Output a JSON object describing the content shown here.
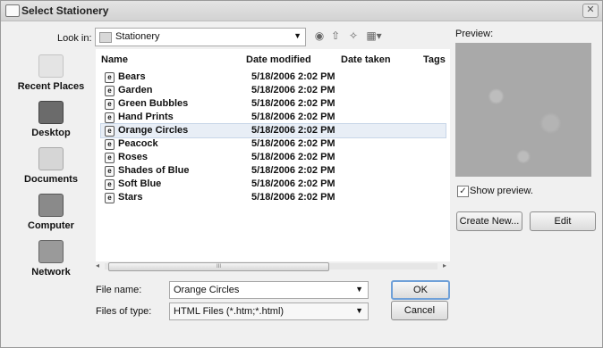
{
  "window": {
    "title": "Select Stationery",
    "close": "✕"
  },
  "lookin": {
    "label": "Look in:",
    "value": "Stationery"
  },
  "places": [
    "Recent Places",
    "Desktop",
    "Documents",
    "Computer",
    "Network"
  ],
  "columns": {
    "name": "Name",
    "date": "Date modified",
    "taken": "Date taken",
    "tags": "Tags"
  },
  "files": [
    {
      "name": "Bears",
      "date": "5/18/2006 2:02 PM"
    },
    {
      "name": "Garden",
      "date": "5/18/2006 2:02 PM"
    },
    {
      "name": "Green Bubbles",
      "date": "5/18/2006 2:02 PM"
    },
    {
      "name": "Hand Prints",
      "date": "5/18/2006 2:02 PM"
    },
    {
      "name": "Orange Circles",
      "date": "5/18/2006 2:02 PM"
    },
    {
      "name": "Peacock",
      "date": "5/18/2006 2:02 PM"
    },
    {
      "name": "Roses",
      "date": "5/18/2006 2:02 PM"
    },
    {
      "name": "Shades of Blue",
      "date": "5/18/2006 2:02 PM"
    },
    {
      "name": "Soft Blue",
      "date": "5/18/2006 2:02 PM"
    },
    {
      "name": "Stars",
      "date": "5/18/2006 2:02 PM"
    }
  ],
  "selected_file": "Orange Circles",
  "scroll_grip": "III",
  "filename": {
    "label": "File name:",
    "value": "Orange Circles"
  },
  "filetype": {
    "label": "Files of type:",
    "value": "HTML Files (*.htm;*.html)"
  },
  "buttons": {
    "ok": "OK",
    "cancel": "Cancel",
    "create_new": "Create New...",
    "edit": "Edit"
  },
  "preview": {
    "label": "Preview:",
    "show_label": "Show preview.",
    "show_checked": true
  },
  "icons": [
    "stationery-folder-icon",
    "back-icon",
    "up-folder-icon",
    "new-folder-icon",
    "views-menu-icon"
  ]
}
